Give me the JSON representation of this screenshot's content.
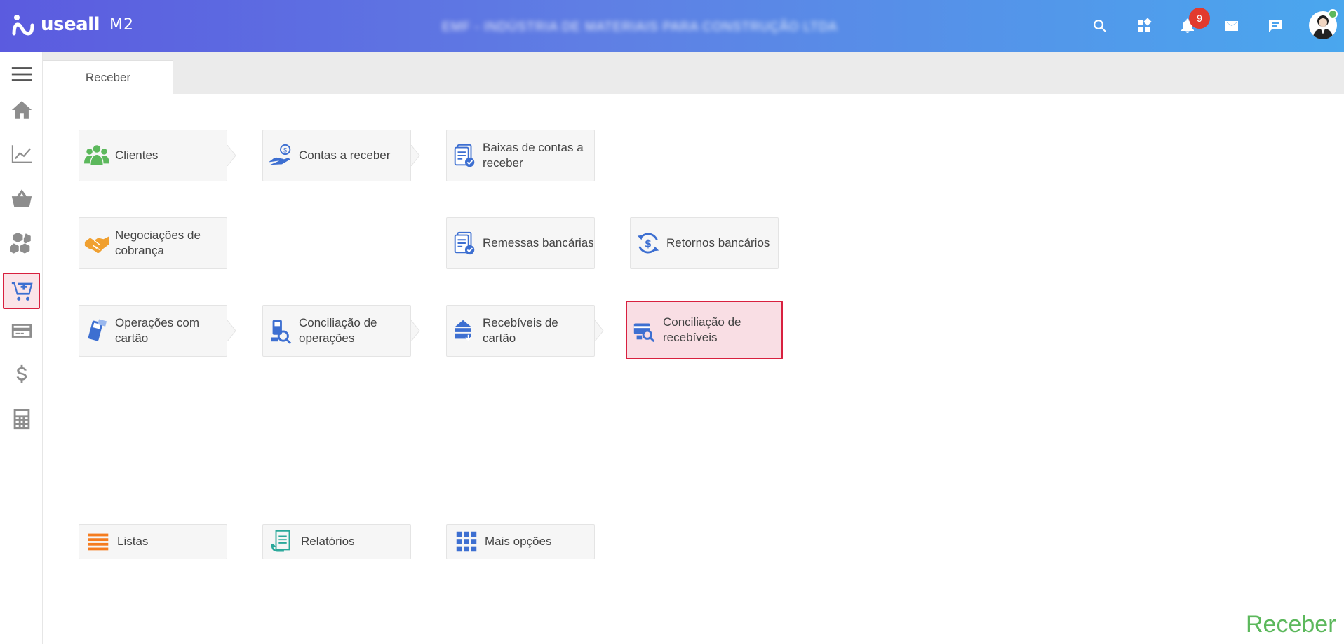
{
  "header": {
    "logo_text": "useall",
    "logo_suffix": "M2",
    "company_name": "EMF - INDÚSTRIA DE MATERIAIS PARA CONSTRUÇÃO LTDA",
    "notification_count": "9"
  },
  "tabs": [
    {
      "label": "Receber",
      "active": true
    }
  ],
  "sidebar": {
    "items": [
      {
        "name": "menu",
        "icon": "hamburger-icon"
      },
      {
        "name": "home",
        "icon": "home-icon"
      },
      {
        "name": "charts",
        "icon": "line-chart-icon"
      },
      {
        "name": "basket",
        "icon": "basket-icon"
      },
      {
        "name": "boxes",
        "icon": "boxes-icon"
      },
      {
        "name": "cart-receive",
        "icon": "cart-plus-icon",
        "active": true
      },
      {
        "name": "card",
        "icon": "credit-card-icon"
      },
      {
        "name": "dollar",
        "icon": "dollar-icon"
      },
      {
        "name": "calculator",
        "icon": "calculator-icon"
      }
    ]
  },
  "tiles": {
    "clientes": "Clientes",
    "contas_receber": "Contas a receber",
    "baixas_line1": "Baixas de contas a",
    "baixas_line2": "receber",
    "negociacoes_line1": "Negociações de",
    "negociacoes_line2": "cobrança",
    "remessas": "Remessas bancárias",
    "retornos": "Retornos bancários",
    "operacoes_line1": "Operações com",
    "operacoes_line2": "cartão",
    "conc_operacoes_line1": "Conciliação de",
    "conc_operacoes_line2": "operações",
    "recebiveis_cartao": "Recebíveis de cartão",
    "conc_recebiveis_line1": "Conciliação de",
    "conc_recebiveis_line2": "recebíveis"
  },
  "bottom": {
    "listas": "Listas",
    "relatorios": "Relatórios",
    "mais_opcoes": "Mais opções"
  },
  "footer": {
    "title": "Receber"
  },
  "colors": {
    "accent": "#d8203f",
    "footer_green": "#5cb85c",
    "header_start": "#5b5bdf",
    "header_end": "#4aa7ee"
  }
}
